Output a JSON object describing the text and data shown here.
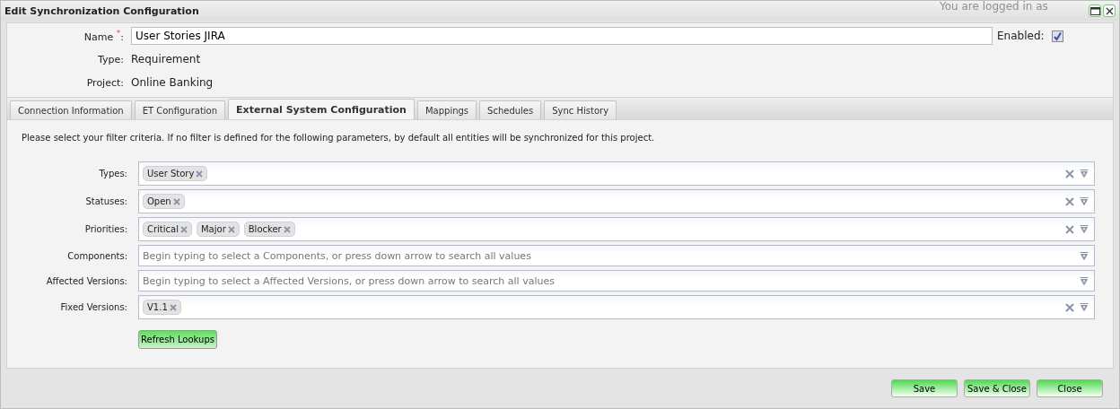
{
  "background_text": "You are logged in as",
  "window": {
    "title": "Edit Synchronization Configuration"
  },
  "header": {
    "name": {
      "label": "Name",
      "required_mark": "*",
      "separator": ":",
      "value": "User Stories JIRA"
    },
    "enabled": {
      "label": "Enabled:",
      "checked": true
    },
    "fields": [
      {
        "label": "Type:",
        "value": "Requirement"
      },
      {
        "label": "Project:",
        "value": "Online Banking"
      }
    ]
  },
  "tabs": [
    {
      "label": "Connection Information",
      "selected": false
    },
    {
      "label": "ET Configuration",
      "selected": false
    },
    {
      "label": "External System Configuration",
      "selected": true
    },
    {
      "label": "Mappings",
      "selected": false
    },
    {
      "label": "Schedules",
      "selected": false
    },
    {
      "label": "Sync History",
      "selected": false
    }
  ],
  "intro": "Please select your filter criteria. If no filter is defined for the following parameters, by default all entities will be synchronized for this project.",
  "filters": [
    {
      "label": "Types:",
      "tags": [
        "User Story"
      ]
    },
    {
      "label": "Statuses:",
      "tags": [
        "Open"
      ]
    },
    {
      "label": "Priorities:",
      "tags": [
        "Critical",
        "Major",
        "Blocker"
      ]
    },
    {
      "label": "Components:",
      "placeholder": "Begin typing to select a Components, or press down arrow to search all values"
    },
    {
      "label": "Affected Versions:",
      "placeholder": "Begin typing to select a Affected Versions, or press down arrow to search all values"
    },
    {
      "label": "Fixed Versions:",
      "tags": [
        "V1.1"
      ]
    }
  ],
  "refresh_button": "Refresh Lookups",
  "buttons": [
    "Save",
    "Save & Close",
    "Close"
  ]
}
